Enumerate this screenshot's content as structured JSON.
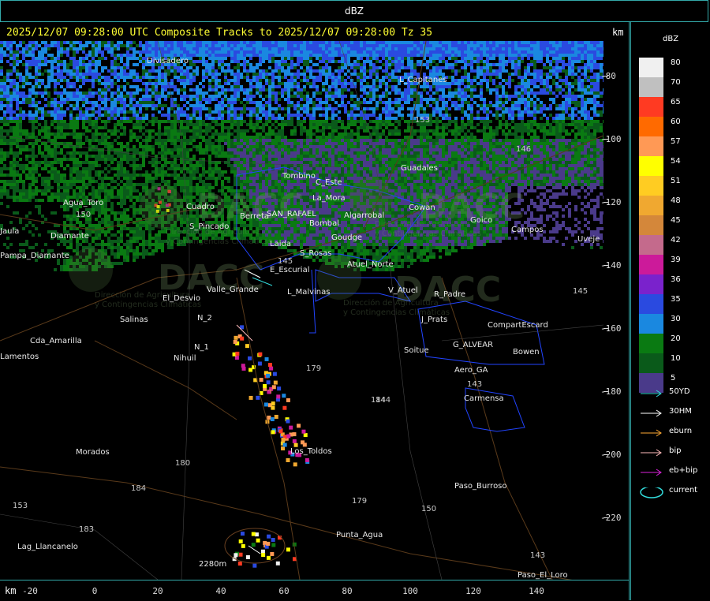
{
  "window": {
    "title": "dBZ"
  },
  "header": {
    "subtitle": "2025/12/07 09:28:00 UTC Composite Tracks to 2025/12/07 09:28:00 Tz 35",
    "km_label": "km"
  },
  "axes": {
    "x_unit": "km",
    "x_ticks": [
      "-20",
      "0",
      "20",
      "40",
      "60",
      "80",
      "100",
      "120",
      "140"
    ],
    "y_ticks": [
      "-80",
      "-100",
      "-120",
      "-140",
      "-160",
      "-180",
      "-200",
      "-220"
    ]
  },
  "legend": {
    "title": "dBZ",
    "levels": [
      {
        "label": "80",
        "color": "#f0f0f0"
      },
      {
        "label": "70",
        "color": "#c0c0c0"
      },
      {
        "label": "65",
        "color": "#ff3a22"
      },
      {
        "label": "60",
        "color": "#ff6a00"
      },
      {
        "label": "57",
        "color": "#ff9955"
      },
      {
        "label": "54",
        "color": "#ffff00"
      },
      {
        "label": "51",
        "color": "#ffcc22"
      },
      {
        "label": "48",
        "color": "#f0a830"
      },
      {
        "label": "45",
        "color": "#d4873a"
      },
      {
        "label": "42",
        "color": "#c46a8c"
      },
      {
        "label": "39",
        "color": "#cc1a9a"
      },
      {
        "label": "36",
        "color": "#7a22cc"
      },
      {
        "label": "35",
        "color": "#2a4ae0"
      },
      {
        "label": "30",
        "color": "#1a88e0"
      },
      {
        "label": "20",
        "color": "#0a7a12"
      },
      {
        "label": "10",
        "color": "#0a5a1a"
      },
      {
        "label": "5",
        "color": "#4a3a8a"
      }
    ],
    "tracks": [
      {
        "label": "50YD",
        "color": "#33dddd",
        "icon": "arrow-icon"
      },
      {
        "label": "30HM",
        "color": "#ffffff",
        "icon": "arrow-icon"
      },
      {
        "label": "eburn",
        "color": "#ffaa33",
        "icon": "arrow-icon"
      },
      {
        "label": "bip",
        "color": "#ffbbbb",
        "icon": "arrow-icon"
      },
      {
        "label": "eb+bip",
        "color": "#dd22dd",
        "icon": "arrow-icon"
      },
      {
        "label": "current",
        "color": "#33dddd",
        "icon": "ellipse-icon"
      }
    ]
  },
  "watermark": "DACC",
  "watermark_subtitle": [
    "Dirección de Agricultura",
    "y Contingencias Climáticas"
  ],
  "places": [
    {
      "name": "Divisadero"
    },
    {
      "name": "Agua_Toro"
    },
    {
      "name": "Diamante"
    },
    {
      "name": "Pampa_Diamante"
    },
    {
      "name": "Salinas"
    },
    {
      "name": "El_Desvio"
    },
    {
      "name": "Valle_Grande"
    },
    {
      "name": "Cda_Amarilla"
    },
    {
      "name": "Nihuil"
    },
    {
      "name": "N_1"
    },
    {
      "name": "N_2"
    },
    {
      "name": "Morados"
    },
    {
      "name": "Lag_Llancanelo"
    },
    {
      "name": "Los_Toldos"
    },
    {
      "name": "Punta_Agua"
    },
    {
      "name": "Paso_Burroso"
    },
    {
      "name": "Paso_El_Loro"
    },
    {
      "name": "Carmensa"
    },
    {
      "name": "Bowen"
    },
    {
      "name": "Soitue"
    },
    {
      "name": "Aero_GA"
    },
    {
      "name": "G_ALVEAR"
    },
    {
      "name": "CompartEscard"
    },
    {
      "name": "J_Prats"
    },
    {
      "name": "R_Padre"
    },
    {
      "name": "V_Atuel"
    },
    {
      "name": "Atuel_Norte"
    },
    {
      "name": "L_Malvinas"
    },
    {
      "name": "E_Escurial"
    },
    {
      "name": "S_Rosas"
    },
    {
      "name": "Laida"
    },
    {
      "name": "Goudge"
    },
    {
      "name": "Bombal"
    },
    {
      "name": "SAN_RAFAEL"
    },
    {
      "name": "Berreta"
    },
    {
      "name": "S_Pincado"
    },
    {
      "name": "Cuadro"
    },
    {
      "name": "Tombino"
    },
    {
      "name": "C_Este"
    },
    {
      "name": "La_Mora"
    },
    {
      "name": "Algarrobal"
    },
    {
      "name": "Guadales"
    },
    {
      "name": "Goico"
    },
    {
      "name": "Campos"
    },
    {
      "name": "Uveje"
    },
    {
      "name": "Cowan"
    },
    {
      "name": "L_Capitanes"
    },
    {
      "name": "2280m"
    },
    {
      "name": "Lamentos"
    },
    {
      "name": "Jaula"
    }
  ],
  "route_numbers": [
    "150",
    "153",
    "146",
    "143",
    "145",
    "144",
    "179",
    "184",
    "180",
    "184",
    "183",
    "179",
    "150",
    "143",
    "153",
    "145"
  ]
}
